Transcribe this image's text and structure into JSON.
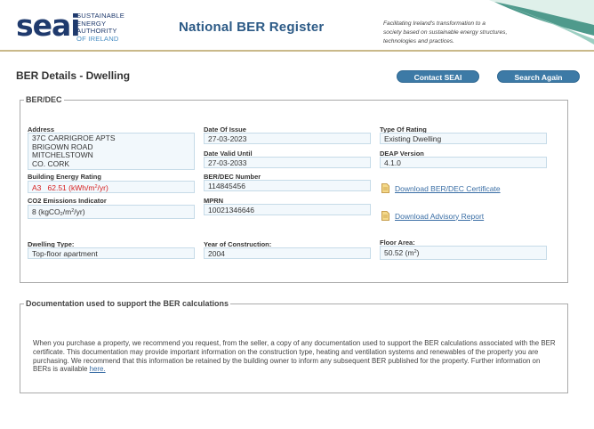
{
  "header": {
    "logo_word": "seai",
    "logo_sub": [
      "SUSTAINABLE",
      "ENERGY AUTHORITY",
      "OF IRELAND"
    ],
    "title": "National BER Register",
    "tagline": [
      "Facilitating Ireland's transformation to a",
      "society based on sustainable energy structures,",
      "technologies and practices."
    ],
    "colors": {
      "navy": "#1f3a6d",
      "teal": "#4f9a8c",
      "light_blue": "#4a8fc4"
    }
  },
  "page": {
    "title": "BER Details - Dwelling",
    "contact_button": "Contact SEAI",
    "search_button": "Search Again"
  },
  "ber": {
    "legend": "BER/DEC",
    "address_label": "Address",
    "address_lines": [
      "37C CARRIGROE APTS",
      "BRIGOWN ROAD",
      "MITCHELSTOWN",
      "CO. CORK"
    ],
    "rating_label": "Building Energy Rating",
    "rating_grade": "A3",
    "rating_value": "62.51",
    "rating_unit_pre": "(kWh/m",
    "rating_unit_sup": "2",
    "rating_unit_post": "/yr)",
    "co2_label": "CO2 Emissions Indicator",
    "co2_value": "8",
    "co2_unit_pre": "(kgCO",
    "co2_unit_sub": "2",
    "co2_unit_mid": "/m",
    "co2_unit_sup": "2",
    "co2_unit_post": "/yr)",
    "date_issue_label": "Date Of Issue",
    "date_issue": "27-03-2023",
    "date_valid_label": "Date Valid Until",
    "date_valid": "27-03-2033",
    "ber_number_label": "BER/DEC Number",
    "ber_number": "114845456",
    "mprn_label": "MPRN",
    "mprn": "10021346646",
    "type_label": "Type Of Rating",
    "type_value": "Existing Dwelling",
    "deap_label": "DEAP Version",
    "deap_value": "4.1.0",
    "download_cert": "Download BER/DEC Certificate",
    "download_report": "Download Advisory Report",
    "dwelling_type_label": "Dwelling Type:",
    "dwelling_type": "Top-floor apartment",
    "year_label": "Year of Construction:",
    "year": "2004",
    "floor_label": "Floor Area:",
    "floor_value": "50.52",
    "floor_unit_pre": "(m",
    "floor_unit_sup": "2",
    "floor_unit_post": ")"
  },
  "docs": {
    "legend": "Documentation used to support the BER calculations",
    "text": "When you purchase a property, we recommend you request, from the seller, a copy of any documentation used to support the BER calculations associated with the BER certificate. This documentation may provide important information on the construction type, heating and ventilation systems and renewables of the property you are purchasing. We recommend that this information be retained by the building owner to inform any subsequent BER published for the property. Further information on BERs is available",
    "link": "here."
  }
}
